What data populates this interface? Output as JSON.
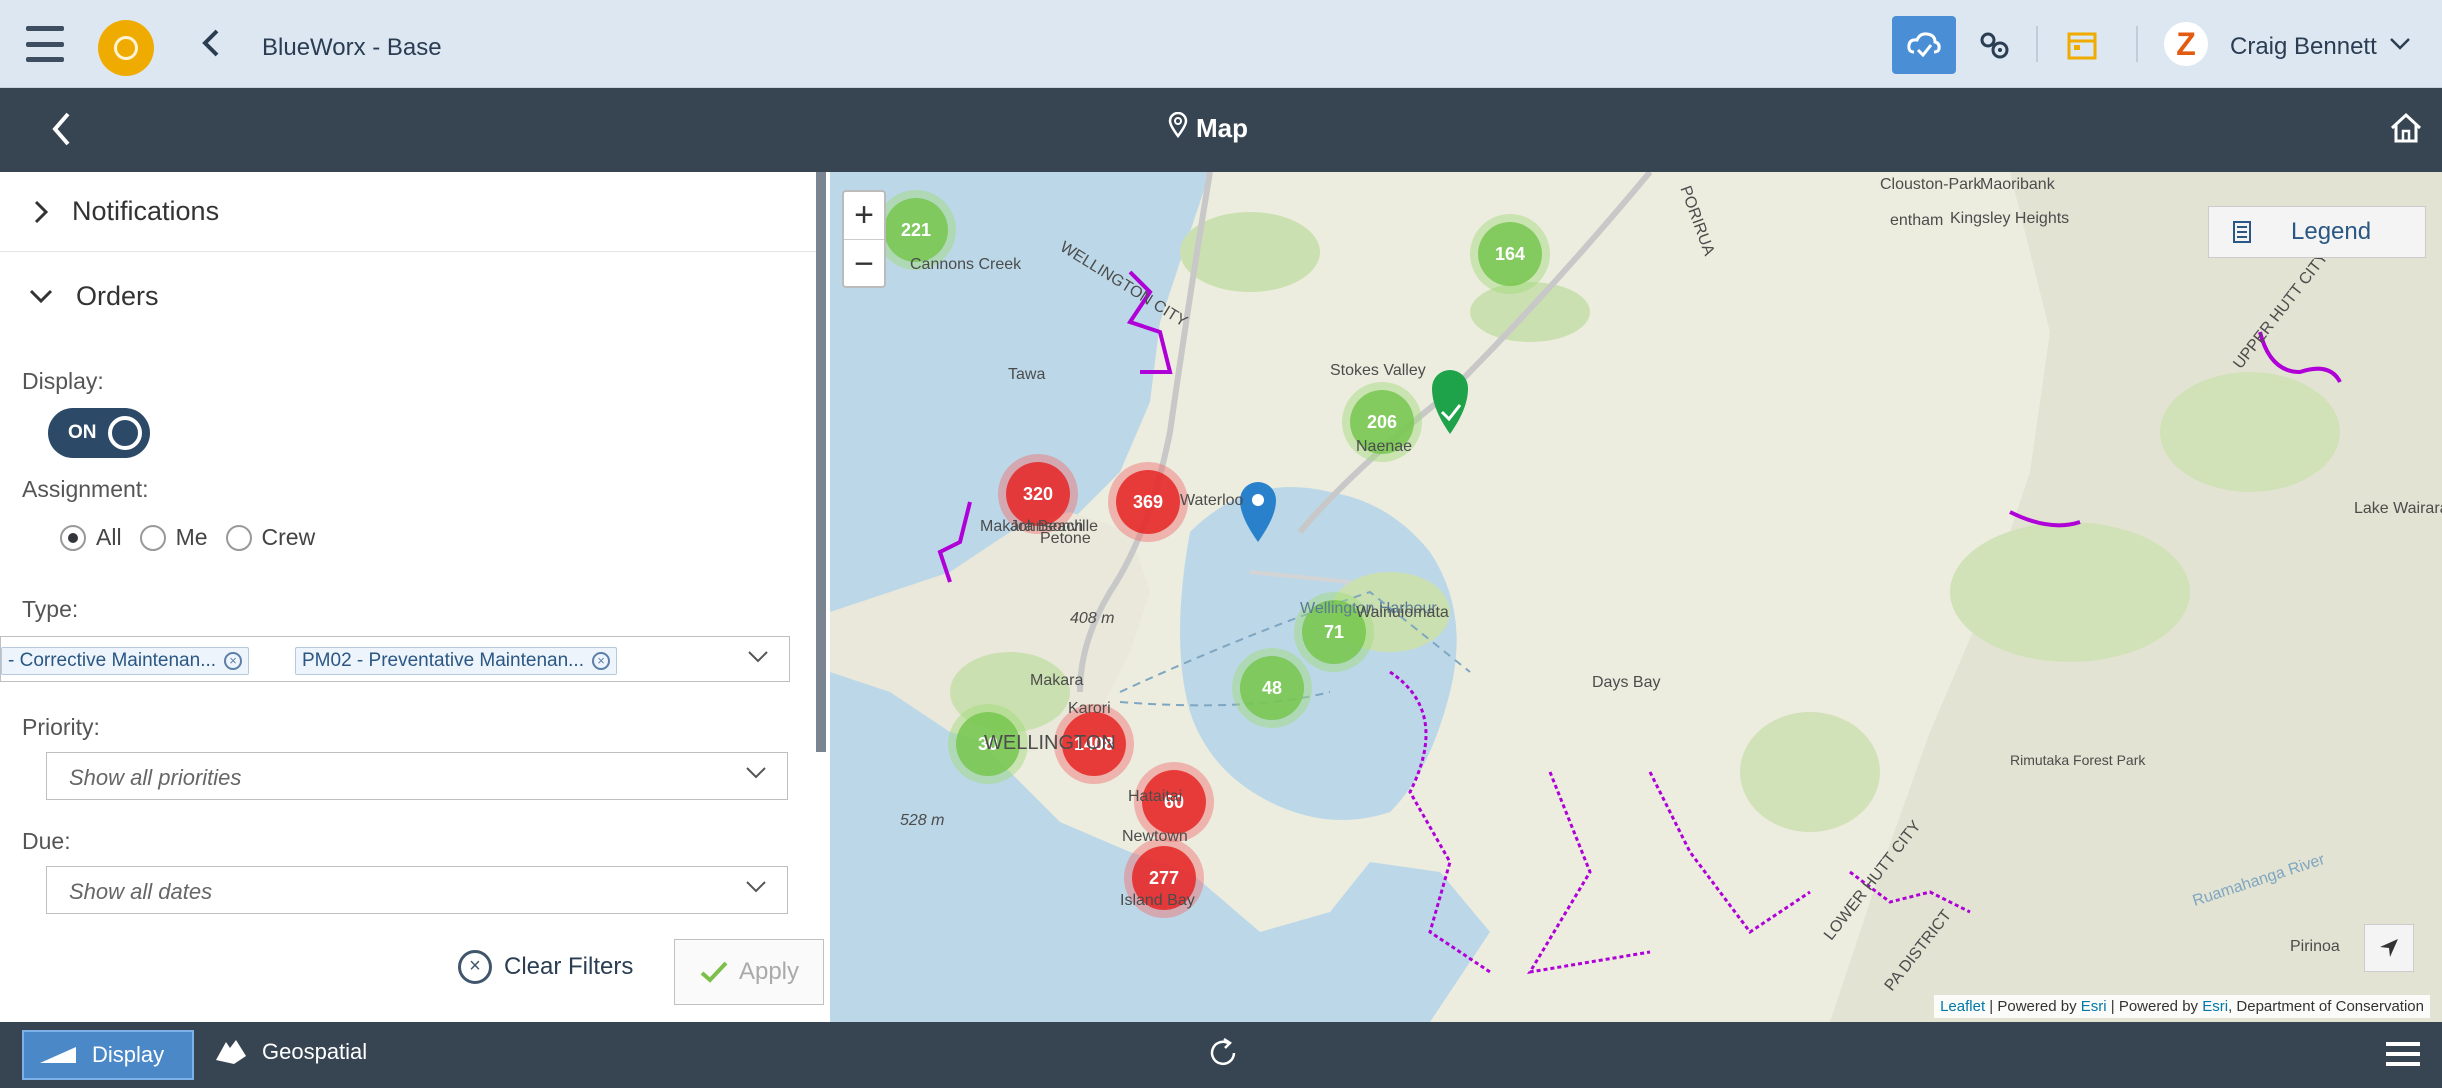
{
  "shell": {
    "app_title": "BlueWorx - Base",
    "user_initial": "Z",
    "user_name": "Craig Bennett",
    "menu_icon": "hamburger-icon",
    "logo_icon": "sap-logo-icon",
    "back_icon": "chevron-left-icon",
    "cloud_icon": "cloud-sync-icon",
    "settings_icon": "gears-icon",
    "calendar_icon": "calendar-icon",
    "user_menu_icon": "chevron-down-icon",
    "accent": "#4a8fd6",
    "brand_orange": "#f0ab00"
  },
  "nav": {
    "title": "Map",
    "back_icon": "chevron-left-icon",
    "map_icon": "map-pin-icon",
    "home_icon": "home-icon",
    "background": "#374552"
  },
  "filters": {
    "notifications_label": "Notifications",
    "orders_label": "Orders",
    "display_label": "Display:",
    "toggle_text": "ON",
    "assignment_label": "Assignment:",
    "assignment_options": [
      "All",
      "Me",
      "Crew"
    ],
    "assignment_selected": "All",
    "type_label": "Type:",
    "type_tokens": [
      "- Corrective Maintenan...",
      "PM02 - Preventative Maintenan..."
    ],
    "priority_label": "Priority:",
    "priority_placeholder": "Show all priorities",
    "due_label": "Due:",
    "due_placeholder": "Show all dates",
    "clear_label": "Clear Filters",
    "apply_label": "Apply"
  },
  "map": {
    "zoom_in": "+",
    "zoom_out": "−",
    "legend_label": "Legend",
    "attribution": {
      "leaflet": "Leaflet",
      "sep1": " | Powered by ",
      "esri1": "Esri",
      "sep2": " | Powered by ",
      "esri2": "Esri",
      "rest": ", Department of Conservation"
    },
    "clusters": [
      {
        "label": "221",
        "color": "green"
      },
      {
        "label": "164",
        "color": "green"
      },
      {
        "label": "206",
        "color": "green"
      },
      {
        "label": "320",
        "color": "red"
      },
      {
        "label": "369",
        "color": "red"
      },
      {
        "label": "71",
        "color": "green"
      },
      {
        "label": "48",
        "color": "green"
      },
      {
        "label": "30",
        "color": "green"
      },
      {
        "label": "1408",
        "color": "red"
      },
      {
        "label": "60",
        "color": "red"
      },
      {
        "label": "277",
        "color": "red"
      }
    ],
    "places": [
      "Clouston-Park",
      "Maoribank",
      "Kingsley Heights",
      "entham",
      "Cannons Creek",
      "WELLINGTON CITY",
      "Tawa",
      "Stokes Valley",
      "Naenae",
      "Waterloo",
      "Petone",
      "Makara Beach",
      "Johnsonville",
      "Lake Wairarapa",
      "408 m",
      "Wellington Harbour",
      "Wainuiomata",
      "Makara",
      "Karori",
      "WELLINGTON",
      "Days Bay",
      "Hataitai",
      "Newtown",
      "Island Bay",
      "528 m",
      "Rimutaka Forest Park",
      "LOWER HUTT CITY",
      "UPPER HUTT CITY",
      "PORIRUA",
      "Pirinoa",
      "Ruamahanga River",
      "PA DISTRICT"
    ]
  },
  "footer": {
    "display_label": "Display",
    "geospatial_label": "Geospatial",
    "refresh_icon": "refresh-icon",
    "menu_icon": "hamburger-icon"
  }
}
